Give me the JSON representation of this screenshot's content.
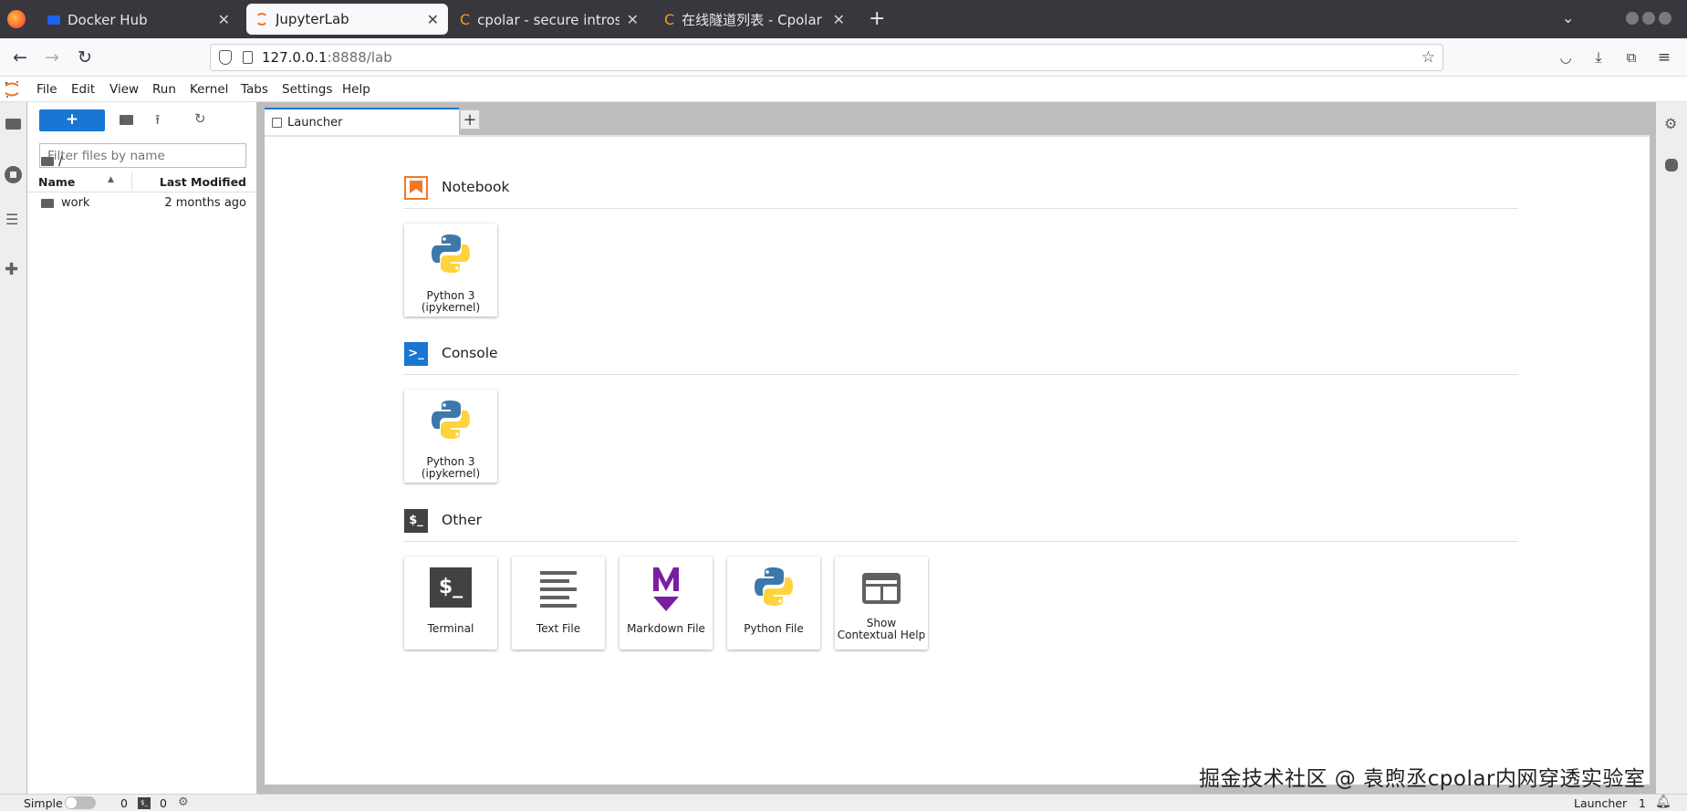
{
  "browser": {
    "tabs": [
      {
        "title": "Docker Hub",
        "active": false
      },
      {
        "title": "JupyterLab",
        "active": true
      },
      {
        "title": "cpolar - secure introspect",
        "active": false
      },
      {
        "title": "在线隧道列表 - Cpolar",
        "active": false
      }
    ],
    "url_host": "127.0.0.1",
    "url_path": ":8888/lab"
  },
  "menubar": [
    "File",
    "Edit",
    "View",
    "Run",
    "Kernel",
    "Tabs",
    "Settings",
    "Help"
  ],
  "filebrowser": {
    "new_label": "+",
    "filter_placeholder": "Filter files by name",
    "breadcrumb": "/",
    "col_name": "Name",
    "col_modified": "Last Modified",
    "items": [
      {
        "name": "work",
        "modified": "2 months ago"
      }
    ]
  },
  "doc_tab": {
    "label": "Launcher"
  },
  "launcher": {
    "notebook": {
      "title": "Notebook",
      "cards": [
        {
          "label": "Python 3\n(ipykernel)"
        }
      ]
    },
    "console": {
      "title": "Console",
      "cards": [
        {
          "label": "Python 3\n(ipykernel)"
        }
      ]
    },
    "other": {
      "title": "Other",
      "cards": [
        {
          "label": "Terminal"
        },
        {
          "label": "Text File"
        },
        {
          "label": "Markdown File"
        },
        {
          "label": "Python File"
        },
        {
          "label": "Show\nContextual Help"
        }
      ]
    }
  },
  "statusbar": {
    "mode": "Simple",
    "kernels": "0",
    "terminals": "0",
    "right_label": "Launcher",
    "right_count": "1"
  },
  "watermark": "掘金技术社区 @ 袁煦丞cpolar内网穿透实验室",
  "colors": {
    "accent": "#1976d2",
    "notebook_orange": "#f37726",
    "markdown_purple": "#7b1fa2"
  }
}
